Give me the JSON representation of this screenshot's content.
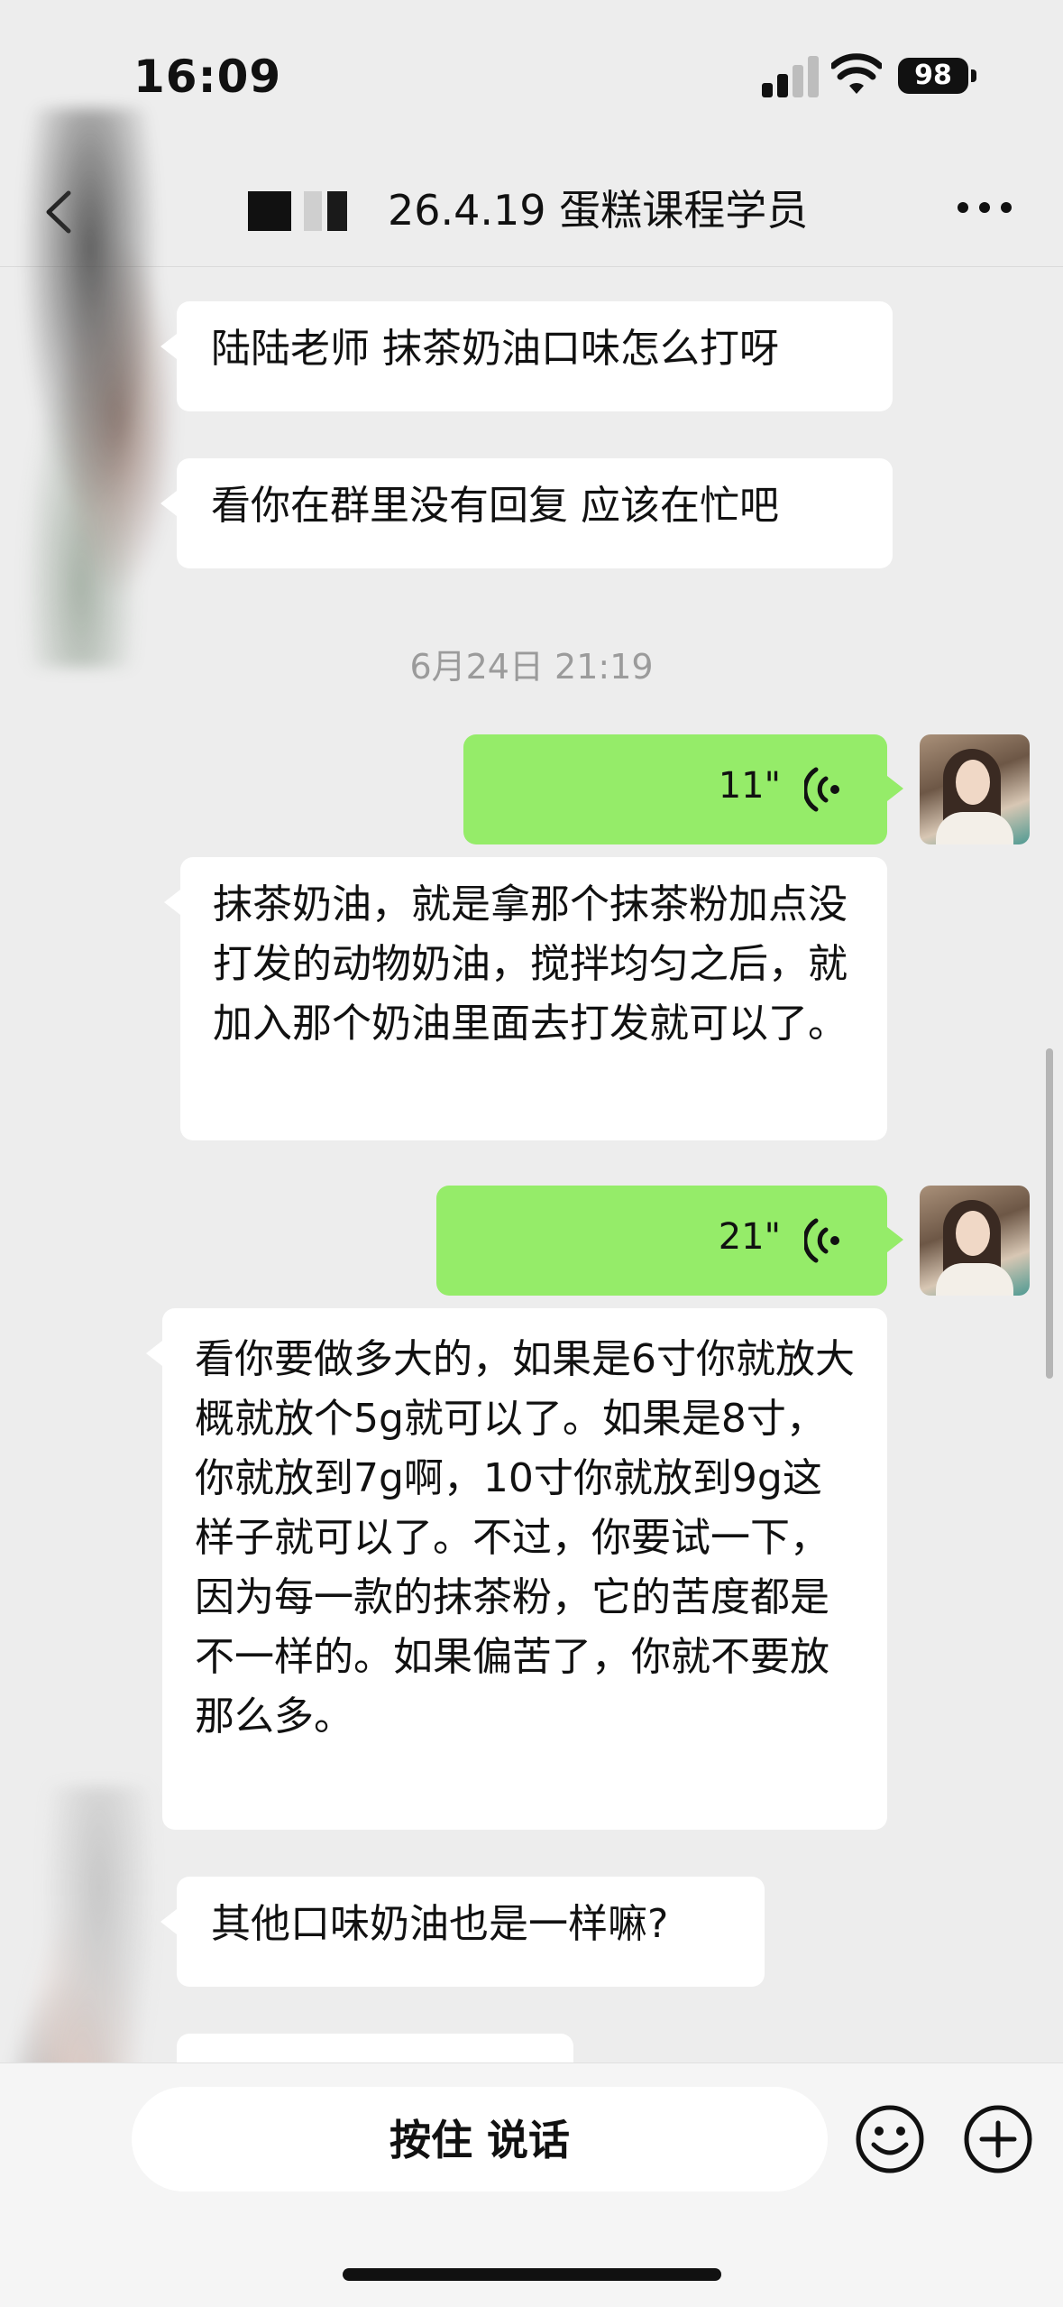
{
  "status_bar": {
    "time": "16:09",
    "battery": "98"
  },
  "header": {
    "title": "26.4.19 蛋糕课程学员"
  },
  "messages": [
    {
      "text": "陆陆老师 抹茶奶油口味怎么打呀"
    },
    {
      "text": "看你在群里没有回复 应该在忙吧"
    },
    {
      "timestamp": "6月24日 21:19"
    },
    {
      "voice_duration": "11\""
    },
    {
      "text": "抹茶奶油，就是拿那个抹茶粉加点没打发的动物奶油，搅拌均匀之后，就加入那个奶油里面去打发就可以了。"
    },
    {
      "voice_duration": "21\""
    },
    {
      "text": "看你要做多大的，如果是6寸你就放大概就放个5g就可以了。如果是8寸，你就放到7g啊，10寸你就放到9g这样子就可以了。不过，你要试一下，因为每一款的抹茶粉，它的苦度都是不一样的。如果偏苦了，你就不要放那么多。"
    },
    {
      "text": "其他口味奶油也是一样嘛?"
    }
  ],
  "input_bar": {
    "hold_to_talk": "按住 说话"
  },
  "icons": {
    "back": "chevron-left-icon",
    "more": "more-icon",
    "emoji": "emoji-icon",
    "plus": "plus-icon",
    "voice": "voice-wave-icon"
  },
  "colors": {
    "outgoing_bubble": "#95ec69",
    "incoming_bubble": "#ffffff",
    "background": "#ededed"
  }
}
